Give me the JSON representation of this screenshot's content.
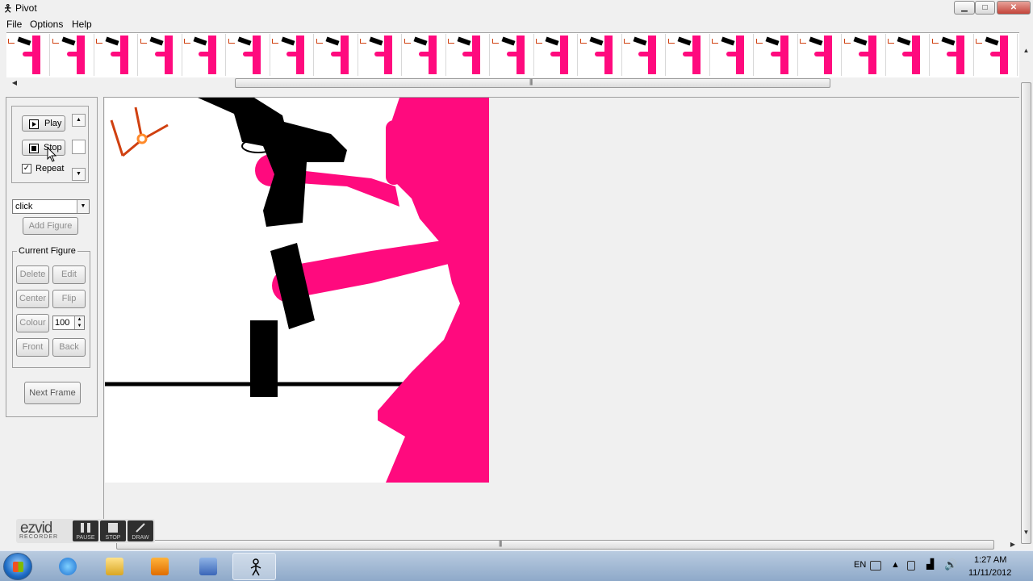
{
  "window": {
    "title": "Pivot",
    "min_glyph": "▁",
    "max_glyph": "□",
    "close_glyph": "✕"
  },
  "menu": {
    "items": [
      {
        "label": "File"
      },
      {
        "label": "Options"
      },
      {
        "label": "Help"
      }
    ]
  },
  "filmstrip": {
    "frame_count": 23
  },
  "playback": {
    "play_label": "Play",
    "stop_label": "Stop",
    "repeat_label": "Repeat",
    "repeat_checked": true
  },
  "figure_type": {
    "selected": "click"
  },
  "add_figure_label": "Add Figure",
  "current_figure": {
    "legend": "Current Figure",
    "delete_label": "Delete",
    "edit_label": "Edit",
    "center_label": "Center",
    "flip_label": "Flip",
    "colour_label": "Colour",
    "colour_value": "100",
    "front_label": "Front",
    "back_label": "Back"
  },
  "next_frame_label": "Next Frame",
  "colors": {
    "figure_pink": "#ff0a7e",
    "gun_black": "#000000",
    "tag_orange": "#d04010"
  },
  "recorder": {
    "logo": "ezvid",
    "logo_sub": "RECORDER",
    "pause_label": "PAUSE",
    "stop_label": "STOP",
    "draw_label": "DRAW"
  },
  "taskbar": {
    "language": "EN",
    "time": "1:27 AM",
    "date": "11/11/2012",
    "apps": [
      {
        "icon": "internet-explorer-icon"
      },
      {
        "icon": "file-explorer-icon"
      },
      {
        "icon": "media-player-icon"
      },
      {
        "icon": "tool-app-icon"
      },
      {
        "icon": "pivot-app-icon",
        "active": true
      }
    ]
  }
}
